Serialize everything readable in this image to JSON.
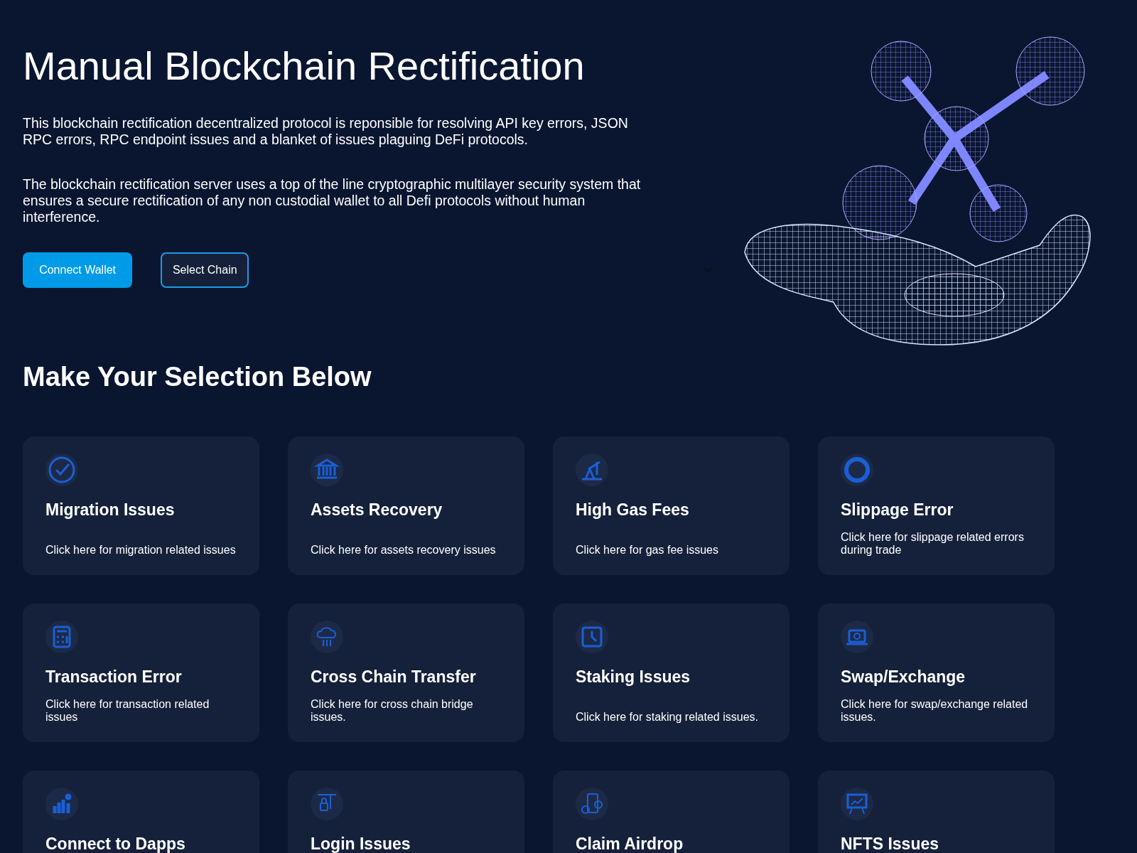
{
  "hero": {
    "title": "Manual Blockchain Rectification",
    "paragraphs": [
      "This blockchain rectification decentralized protocol is reponsible for resolving API key errors, JSON RPC errors, RPC endpoint issues and a blanket of issues plaguing DeFi protocols.",
      "The blockchain rectification server uses a top of the line cryptographic multilayer security system that ensures a secure rectification of any non custodial wallet to all Defi protocols without human interference."
    ],
    "buttons": [
      {
        "label": "Connect Wallet",
        "kind": "primary"
      },
      {
        "label": "Select Chain",
        "kind": "outline"
      }
    ]
  },
  "section_title": "Make Your Selection Below",
  "cards": [
    {
      "title": "Migration Issues",
      "description": "Click here for migration related issues"
    },
    {
      "title": "Assets Recovery",
      "description": "Click here for assets recovery issues"
    },
    {
      "title": "High Gas Fees",
      "description": "Click here for gas fee issues"
    },
    {
      "title": "Slippage Error",
      "description": "Click here for slippage related errors during trade"
    },
    {
      "title": "Transaction Error",
      "description": "Click here for transaction related issues"
    },
    {
      "title": "Cross Chain Transfer",
      "description": "Click here for cross chain bridge issues."
    },
    {
      "title": "Staking Issues",
      "description": "Click here for staking related issues."
    },
    {
      "title": "Swap/Exchange",
      "description": "Click here for swap/exchange related issues."
    },
    {
      "title": "Connect to Dapps"
    },
    {
      "title": "Login Issues"
    },
    {
      "title": "Claim Airdrop"
    },
    {
      "title": "NFTS Issues"
    }
  ]
}
